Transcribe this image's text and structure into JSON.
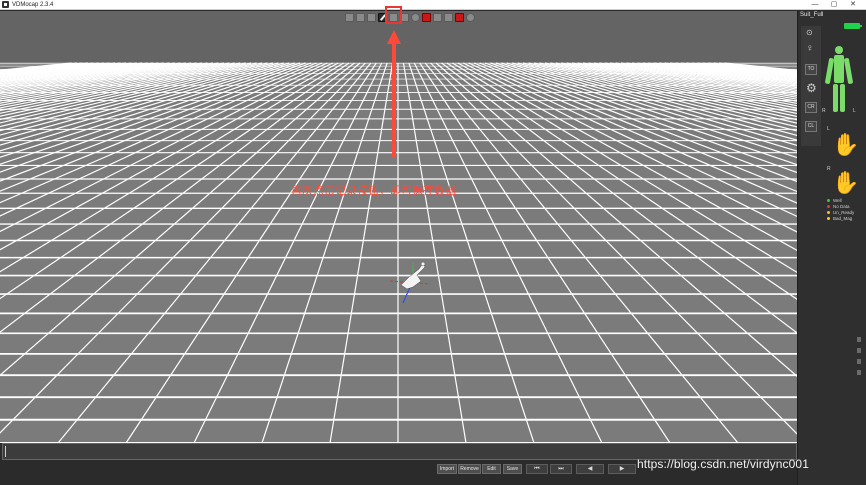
{
  "window": {
    "title": "VDMocap 2.3.4",
    "controls": [
      "—",
      "▢",
      "✕"
    ]
  },
  "toolbar": {
    "buttons": [
      {
        "icon": "playback-icon"
      },
      {
        "icon": "playback-icon"
      },
      {
        "icon": "playback-icon"
      },
      {
        "icon": "record-pen-icon"
      },
      {
        "icon": "export-icon"
      },
      {
        "icon": "camera-icon"
      },
      {
        "icon": "target-icon"
      },
      {
        "icon": "stop-icon"
      },
      {
        "icon": "playback-icon"
      },
      {
        "icon": "playback-icon"
      },
      {
        "icon": "stop-icon"
      },
      {
        "icon": "help-icon"
      }
    ]
  },
  "annotation": {
    "text": "再次点击记录按钮，即可保存数据"
  },
  "right_panel": {
    "suit_label": "Suit_Full",
    "side_buttons": [
      "TO",
      "CR",
      "CL"
    ],
    "hand_labels": {
      "left": "L",
      "right": "R"
    },
    "body_side_labels": {
      "right": "R",
      "left": "L"
    },
    "legend": [
      {
        "label": "Well",
        "color": "#2ecc40"
      },
      {
        "label": "No Data",
        "color": "#e53935"
      },
      {
        "label": "Un_Ready",
        "color": "#f1c40f"
      },
      {
        "label": "Bad_Mag",
        "color": "#e0e000"
      }
    ]
  },
  "bottom": {
    "buttons": [
      "Import",
      "Remove",
      "Edit",
      "Save"
    ],
    "playback": [
      "⏮",
      "⏭",
      "◀",
      "▶"
    ]
  },
  "watermark": "https://blog.csdn.net/virdync001",
  "colors": {
    "floor": "#7b7b7b",
    "grid_line": "#ffffff",
    "highlight": "#e53935",
    "battery": "#22d14a",
    "skeleton": "#7bdc6a"
  }
}
